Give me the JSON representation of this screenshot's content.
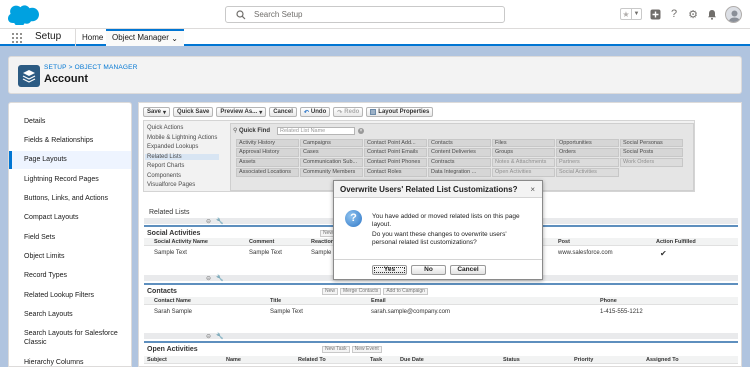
{
  "header": {
    "search_placeholder": "Search Setup",
    "icons": [
      "star-icon",
      "dropdown-icon",
      "add-icon",
      "help-icon",
      "gear-icon",
      "bell-icon",
      "avatar"
    ]
  },
  "nav": {
    "app_name": "Setup",
    "tabs": [
      {
        "label": "Home"
      },
      {
        "label": "Object Manager"
      }
    ]
  },
  "object_header": {
    "breadcrumb_setup": "SETUP",
    "breadcrumb_sep": ">",
    "breadcrumb_object_manager": "OBJECT MANAGER",
    "title": "Account"
  },
  "sidebar": {
    "items": [
      {
        "label": "Details"
      },
      {
        "label": "Fields & Relationships"
      },
      {
        "label": "Page Layouts"
      },
      {
        "label": "Lightning Record Pages"
      },
      {
        "label": "Buttons, Links, and Actions"
      },
      {
        "label": "Compact Layouts"
      },
      {
        "label": "Field Sets"
      },
      {
        "label": "Object Limits"
      },
      {
        "label": "Record Types"
      },
      {
        "label": "Related Lookup Filters"
      },
      {
        "label": "Search Layouts"
      },
      {
        "label": "Search Layouts for Salesforce"
      },
      {
        "label": "Classic"
      },
      {
        "label": "Hierarchy Columns"
      }
    ],
    "active_index": 2
  },
  "toolbar": {
    "save": "Save",
    "quick_save": "Quick Save",
    "preview_as": "Preview As...",
    "cancel": "Cancel",
    "undo": "Undo",
    "redo": "Redo",
    "layout_properties": "Layout Properties"
  },
  "palette": {
    "categories": [
      "Quick Actions",
      "Mobile & Lightning Actions",
      "Expanded Lookups",
      "Related Lists",
      "Report Charts",
      "Components",
      "Visualforce Pages"
    ],
    "selected_category": "Related Lists",
    "quick_find_label": "Quick Find",
    "quick_find_placeholder": "Related List Name",
    "fields": [
      [
        "Activity History",
        "Campaigns",
        "Contact Point Add...",
        "Contacts",
        "Files",
        "Opportunities",
        "Social Personas"
      ],
      [
        "Approval History",
        "Cases",
        "Contact Point Emails",
        "Content Deliveries",
        "Groups",
        "Orders",
        "Social Posts"
      ],
      [
        "Assets",
        "Communication Sub...",
        "Contact Point Phones",
        "Contracts",
        "Notes & Attachments",
        "Partners",
        "Work Orders"
      ],
      [
        "Associated Locations",
        "Community Members",
        "Contact Roles",
        "Data Integration ...",
        "Open Activities",
        "Social Activities",
        ""
      ]
    ]
  },
  "related": {
    "title": "Related Lists",
    "social": {
      "title": "Social Activities",
      "btn_new": "New",
      "columns": [
        "Social Activity Name",
        "Comment",
        "Reaction",
        "Post",
        "Action Fulfilled"
      ],
      "row": [
        "Sample Text",
        "Sample Text",
        "Sample T",
        "www.salesforce.com",
        "✔"
      ]
    },
    "contacts": {
      "title": "Contacts",
      "buttons": [
        "New",
        "Merge Contacts",
        "Add to Campaign"
      ],
      "columns": [
        "Contact Name",
        "Title",
        "Email",
        "Phone"
      ],
      "row": [
        "Sarah Sample",
        "Sample Text",
        "sarah.sample@company.com",
        "1-415-555-1212"
      ]
    },
    "open_activities": {
      "title": "Open Activities",
      "buttons": [
        "New Task",
        "New Event"
      ],
      "columns": [
        "Subject",
        "Name",
        "Related To",
        "Task",
        "Due Date",
        "Status",
        "Priority",
        "Assigned To"
      ]
    }
  },
  "dialog": {
    "title": "Overwrite Users' Related List Customizations?",
    "close": "×",
    "message1": "You have added or moved related lists on this page layout.",
    "message2": "Do you want these changes to overwrite users' personal related list customizations?",
    "yes": "Yes",
    "no": "No",
    "cancel": "Cancel"
  },
  "colors": {
    "brand_blue": "#0176d3",
    "object_icon": "#2c5b83",
    "background": "#b0c4df",
    "section_border": "#5e8fbe"
  }
}
